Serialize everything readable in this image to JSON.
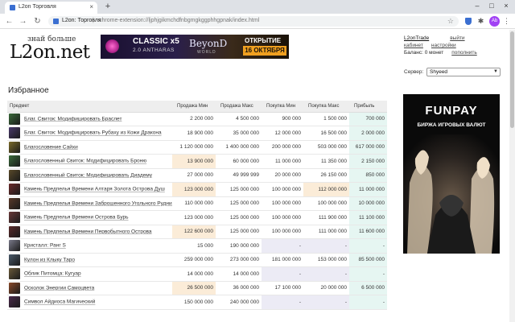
{
  "browser": {
    "tab_title": "L2on Торговля",
    "tab_close": "×",
    "new_tab": "+",
    "win_min": "–",
    "win_max": "□",
    "win_close": "×",
    "omnibox_origin": "L2on: Торговля",
    "omnibox_sep": "|",
    "url": "chrome-extension://ljphjgikmchdfnbgmgkggphhgpnak/index.html",
    "profile_initials": "Ab",
    "back_icon": "←",
    "forward_icon": "→",
    "reload_icon": "↻",
    "star_icon": "☆",
    "puzzle_icon": "✱",
    "menu_icon": "⋮"
  },
  "header": {
    "logo_tagline": "знай больше",
    "logo_main": "L2on.net",
    "banner": {
      "classic": "CLASSIC x5",
      "subtitle": "2.0 ANTHARAS",
      "beyond": "BeyonD",
      "beyond_sub": "WORLD",
      "opening": "ОТКРЫТИЕ",
      "date": "16 ОКТЯБРЯ"
    }
  },
  "user": {
    "name": "L2onTrade",
    "logout": "выйти",
    "cabinet": "кабинет",
    "settings": "настройки",
    "balance": "Баланс: 0 монет",
    "topup": "пополнить"
  },
  "server": {
    "label": "Сервер:",
    "selected": "Shyeed"
  },
  "section_title": "Избранное",
  "table": {
    "headers": [
      "Предмет",
      "Продажа Мин",
      "Продажа Макс",
      "Покупка Мин",
      "Покупка Макс",
      "Прибыль"
    ],
    "rows": [
      {
        "name": "Благ. Свиток: Модифицировать Браслет",
        "icon": "#3a6a3a",
        "sell_min": "2 200 000",
        "sell_max": "4 500 000",
        "buy_min": "900 000",
        "buy_max": "1 500 000",
        "profit": "700 000",
        "sell_hl": false,
        "buy_hl": false,
        "buy_empty": false,
        "sell_empty": false
      },
      {
        "name": "Благ. Свиток: Модифицировать Рубаху из Кожи Дракона",
        "icon": "#4a3a6a",
        "sell_min": "18 900 000",
        "sell_max": "35 000 000",
        "buy_min": "12 000 000",
        "buy_max": "16 500 000",
        "profit": "2 000 000",
        "sell_hl": false,
        "buy_hl": false,
        "buy_empty": false,
        "sell_empty": false
      },
      {
        "name": "Благословение Сайхи",
        "icon": "#7a6a2a",
        "sell_min": "1 120 000 000",
        "sell_max": "1 400 000 000",
        "buy_min": "200 000 000",
        "buy_max": "503 000 000",
        "profit": "617 000 000",
        "sell_hl": false,
        "buy_hl": false,
        "buy_empty": false,
        "sell_empty": false
      },
      {
        "name": "Благословенный Свиток: Модифицировать Броню",
        "icon": "#3a6a3a",
        "sell_min": "13 900 000",
        "sell_max": "60 000 000",
        "buy_min": "11 000 000",
        "buy_max": "11 350 000",
        "profit": "2 150 000",
        "sell_hl": true,
        "buy_hl": false,
        "buy_empty": false,
        "sell_empty": false
      },
      {
        "name": "Благословенный Свиток: Модифицировать Диадему",
        "icon": "#5a4a2a",
        "sell_min": "27 000 000",
        "sell_max": "49 999 999",
        "buy_min": "20 000 000",
        "buy_max": "26 150 000",
        "profit": "850 000",
        "sell_hl": false,
        "buy_hl": false,
        "buy_empty": false,
        "sell_empty": false
      },
      {
        "name": "Камень Предпелья Времени Алтаря Золота Острова Душ",
        "icon": "#6a2a2a",
        "sell_min": "123 000 000",
        "sell_max": "125 000 000",
        "buy_min": "100 000 000",
        "buy_max": "112 000 000",
        "profit": "11 000 000",
        "sell_hl": true,
        "buy_hl": true,
        "buy_empty": false,
        "sell_empty": false
      },
      {
        "name": "Камень Предпелья Времени Заброшенного Угольного Рудника",
        "icon": "#5a3a2a",
        "sell_min": "110 000 000",
        "sell_max": "125 000 000",
        "buy_min": "100 000 000",
        "buy_max": "100 000 000",
        "profit": "10 000 000",
        "sell_hl": false,
        "buy_hl": false,
        "buy_empty": false,
        "sell_empty": false
      },
      {
        "name": "Камень Предпелья Времени Острова Бурь",
        "icon": "#6a3a3a",
        "sell_min": "123 000 000",
        "sell_max": "125 000 000",
        "buy_min": "100 000 000",
        "buy_max": "111 900 000",
        "profit": "11 100 000",
        "sell_hl": false,
        "buy_hl": false,
        "buy_empty": false,
        "sell_empty": false
      },
      {
        "name": "Камень Предпелья Времени Первобытного Острова",
        "icon": "#5a2a2a",
        "sell_min": "122 600 000",
        "sell_max": "125 000 000",
        "buy_min": "100 000 000",
        "buy_max": "111 000 000",
        "profit": "11 600 000",
        "sell_hl": true,
        "buy_hl": false,
        "buy_empty": false,
        "sell_empty": false
      },
      {
        "name": "Кристалл: Ранг S",
        "icon": "#7a7a8a",
        "sell_min": "15 000",
        "sell_max": "190 000 000",
        "buy_min": "-",
        "buy_max": "-",
        "profit": "-",
        "sell_hl": false,
        "buy_hl": false,
        "buy_empty": true,
        "sell_empty": false
      },
      {
        "name": "Кулон из Клыку Таро",
        "icon": "#4a5a6a",
        "sell_min": "259 000 000",
        "sell_max": "273 000 000",
        "buy_min": "181 000 000",
        "buy_max": "153 000 000",
        "profit": "85 500 000",
        "sell_hl": false,
        "buy_hl": false,
        "buy_empty": false,
        "sell_empty": false
      },
      {
        "name": "Облик Питомца: Кугуар",
        "icon": "#6a5a3a",
        "sell_min": "14 000 000",
        "sell_max": "14 000 000",
        "buy_min": "-",
        "buy_max": "-",
        "profit": "-",
        "sell_hl": false,
        "buy_hl": false,
        "buy_empty": true,
        "sell_empty": false
      },
      {
        "name": "Осколок Энергии Самоцвета",
        "icon": "#8a4a2a",
        "sell_min": "26 500 000",
        "sell_max": "36 000 000",
        "buy_min": "17 100 000",
        "buy_max": "20 000 000",
        "profit": "6 500 000",
        "sell_hl": true,
        "buy_hl": false,
        "buy_empty": false,
        "sell_empty": false
      },
      {
        "name": "Символ Айдиоса Магический",
        "icon": "#4a2a4a",
        "sell_min": "150 000 000",
        "sell_max": "240 000 000",
        "buy_min": "-",
        "buy_max": "-",
        "profit": "-",
        "sell_hl": false,
        "buy_hl": false,
        "buy_empty": true,
        "sell_empty": false
      }
    ]
  },
  "ad": {
    "logo": "FUNPAY",
    "subtitle": "БИРЖА ИГРОВЫХ ВАЛЮТ"
  },
  "colors": {
    "sell_highlight": "#fbecd8",
    "empty": "#ecebf5",
    "profit_bg": "#e6f6f2",
    "header_bg": "#eeeeee"
  }
}
